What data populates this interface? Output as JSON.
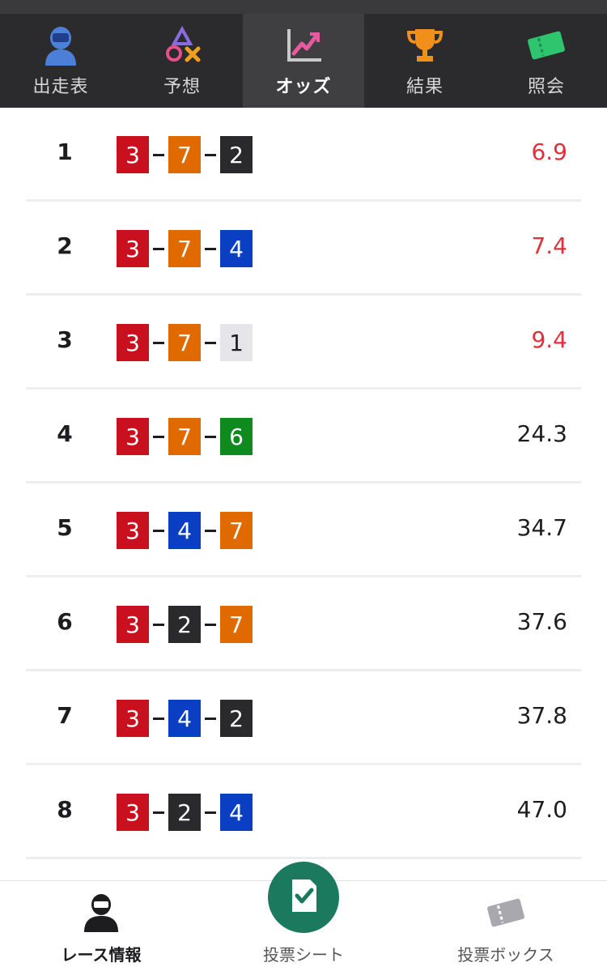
{
  "top_nav": {
    "tabs": [
      {
        "label": "出走表",
        "icon": "racer-icon",
        "active": false
      },
      {
        "label": "予想",
        "icon": "prediction-shapes-icon",
        "active": false
      },
      {
        "label": "オッズ",
        "icon": "odds-chart-icon",
        "active": true
      },
      {
        "label": "結果",
        "icon": "trophy-icon",
        "active": false
      },
      {
        "label": "照会",
        "icon": "ticket-icon",
        "active": false
      }
    ]
  },
  "boat_colors": {
    "1": {
      "bg": "#e6e6ea",
      "fg": "#1d1d1f"
    },
    "2": {
      "bg": "#2a2a2c",
      "fg": "#ffffff"
    },
    "3": {
      "bg": "#c8101e",
      "fg": "#ffffff"
    },
    "4": {
      "bg": "#0a3fc4",
      "fg": "#ffffff"
    },
    "6": {
      "bg": "#0f8a1e",
      "fg": "#ffffff"
    },
    "7": {
      "bg": "#e06a00",
      "fg": "#ffffff"
    }
  },
  "odds_rows": [
    {
      "rank": "1",
      "combo": [
        "3",
        "7",
        "2"
      ],
      "odds": "6.9",
      "hot": true
    },
    {
      "rank": "2",
      "combo": [
        "3",
        "7",
        "4"
      ],
      "odds": "7.4",
      "hot": true
    },
    {
      "rank": "3",
      "combo": [
        "3",
        "7",
        "1"
      ],
      "odds": "9.4",
      "hot": true
    },
    {
      "rank": "4",
      "combo": [
        "3",
        "7",
        "6"
      ],
      "odds": "24.3",
      "hot": false
    },
    {
      "rank": "5",
      "combo": [
        "3",
        "4",
        "7"
      ],
      "odds": "34.7",
      "hot": false
    },
    {
      "rank": "6",
      "combo": [
        "3",
        "2",
        "7"
      ],
      "odds": "37.6",
      "hot": false
    },
    {
      "rank": "7",
      "combo": [
        "3",
        "4",
        "2"
      ],
      "odds": "37.8",
      "hot": false
    },
    {
      "rank": "8",
      "combo": [
        "3",
        "2",
        "4"
      ],
      "odds": "47.0",
      "hot": false
    }
  ],
  "bottom_bar": {
    "race_info_label": "レース情報",
    "bet_sheet_label": "投票シート",
    "bet_box_label": "投票ボックス"
  },
  "colors": {
    "hot_odds": "#e0303a",
    "sheet_button": "#1b7a5e",
    "nav_bg": "#2b2b2d",
    "nav_active_bg": "#3f3f42"
  }
}
